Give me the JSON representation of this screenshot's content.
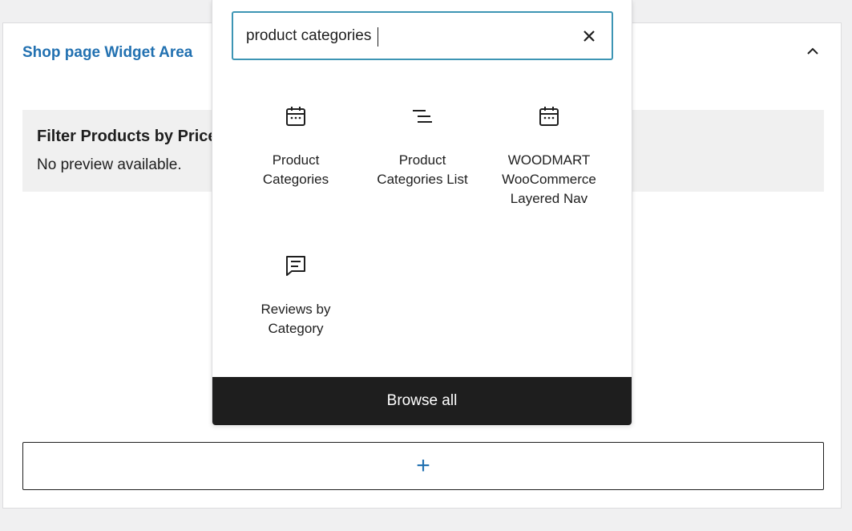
{
  "widget_area": {
    "title": "Shop page Widget Area",
    "collapse_icon": "chevron-up-icon",
    "widget": {
      "title": "Filter Products by Price",
      "note": "No preview available."
    },
    "add_block_label": "+"
  },
  "inserter": {
    "search": {
      "value": "product categories",
      "clear_icon": "close-icon"
    },
    "results": [
      {
        "label_line1": "Product",
        "label_line2": "Categories",
        "label_line3": "",
        "icon": "calendar-icon"
      },
      {
        "label_line1": "Product",
        "label_line2": "Categories List",
        "label_line3": "",
        "icon": "list-lines-icon"
      },
      {
        "label_line1": "WOODMART",
        "label_line2": "WooCommerce",
        "label_line3": "Layered Nav",
        "icon": "calendar-icon"
      },
      {
        "label_line1": "Reviews by",
        "label_line2": "Category",
        "label_line3": "",
        "icon": "comment-icon"
      }
    ],
    "browse_all_label": "Browse all"
  },
  "colors": {
    "accent": "#2271b1",
    "focus_border": "#3d95b4",
    "dark": "#1e1e1e"
  }
}
